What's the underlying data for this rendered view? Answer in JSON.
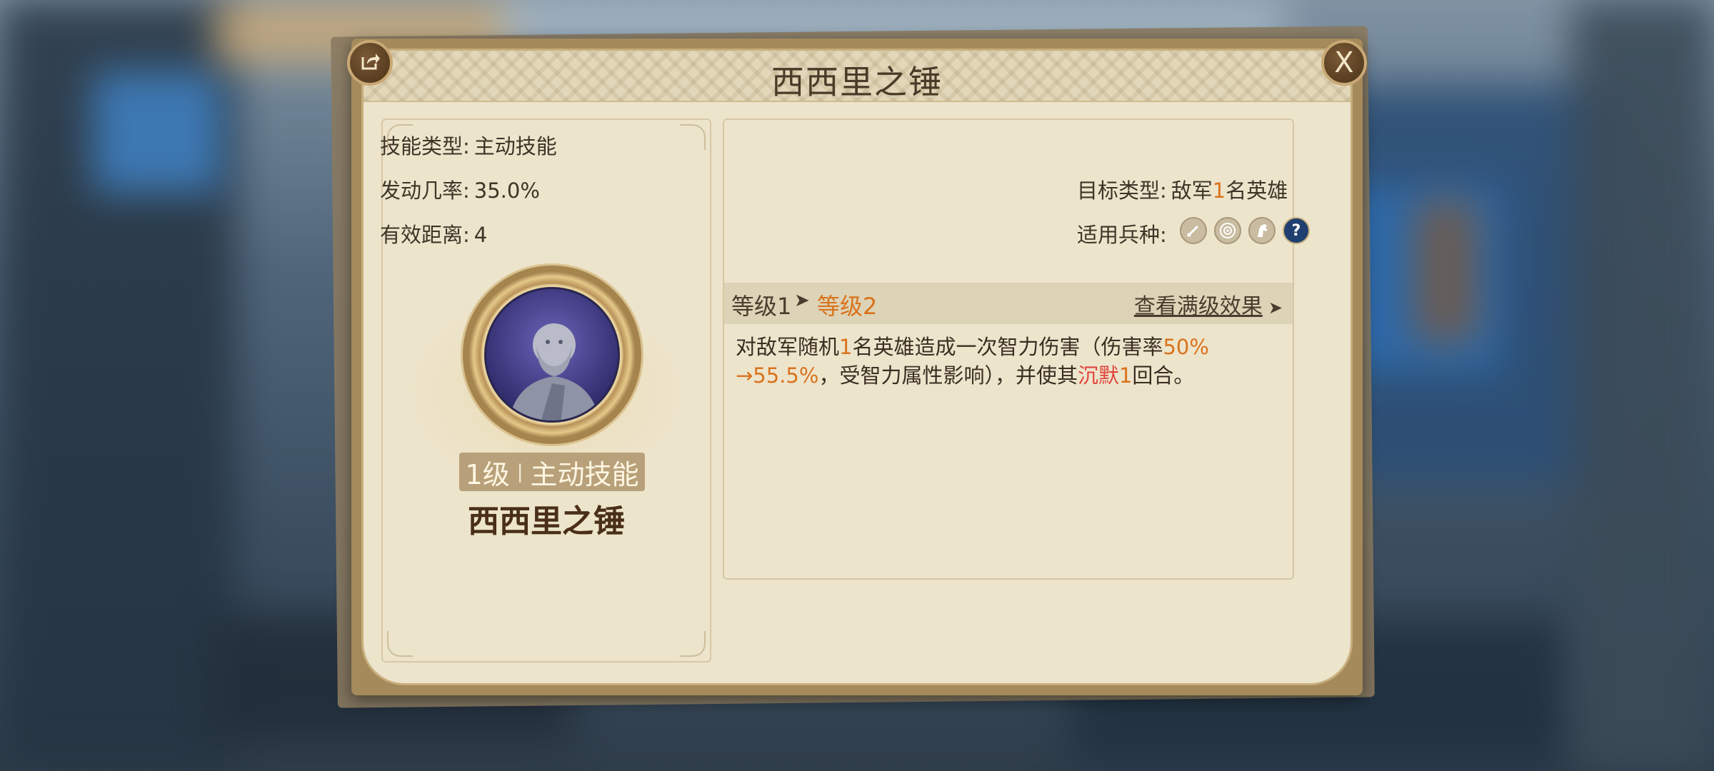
{
  "dialog": {
    "title": "西西里之锤",
    "close_label": "X"
  },
  "skill": {
    "level_badge_level": "1级",
    "level_badge_sep": "|",
    "level_badge_type": "主动技能",
    "name": "西西里之锤"
  },
  "stats": {
    "type_label": "技能类型:",
    "type_value": "主动技能",
    "chance_label": "发动几率:",
    "chance_value": "35.0%",
    "target_label": "目标类型:",
    "target_prefix": "敌军",
    "target_count": "1",
    "target_suffix": "名英雄",
    "range_label": "有效距离:",
    "range_value": "4",
    "troops_label": "适用兵种:",
    "troop_icons": [
      "sword-icon",
      "target-icon",
      "horse-icon",
      "question-icon"
    ],
    "troop_unknown_glyph": "?"
  },
  "level_bar": {
    "from": "等级1",
    "arrow": "➤",
    "to": "等级2",
    "full_effect": "查看满级效果",
    "full_effect_arrow": "➤"
  },
  "description": {
    "p1": "对敌军随机",
    "n1": "1",
    "p2": "名英雄造成一次智力伤害（伤害率",
    "rate_from": "50%",
    "rate_arrow_to": "→55.5%",
    "p3": "，受智力属性影响），并使其",
    "status": "沉默",
    "n2": "1",
    "p4": "回合。"
  },
  "colors": {
    "accent_orange": "#d9731c",
    "status_red": "#e1453b",
    "frame_gold": "#a58a5c",
    "panel_bg": "#ede4cc"
  }
}
